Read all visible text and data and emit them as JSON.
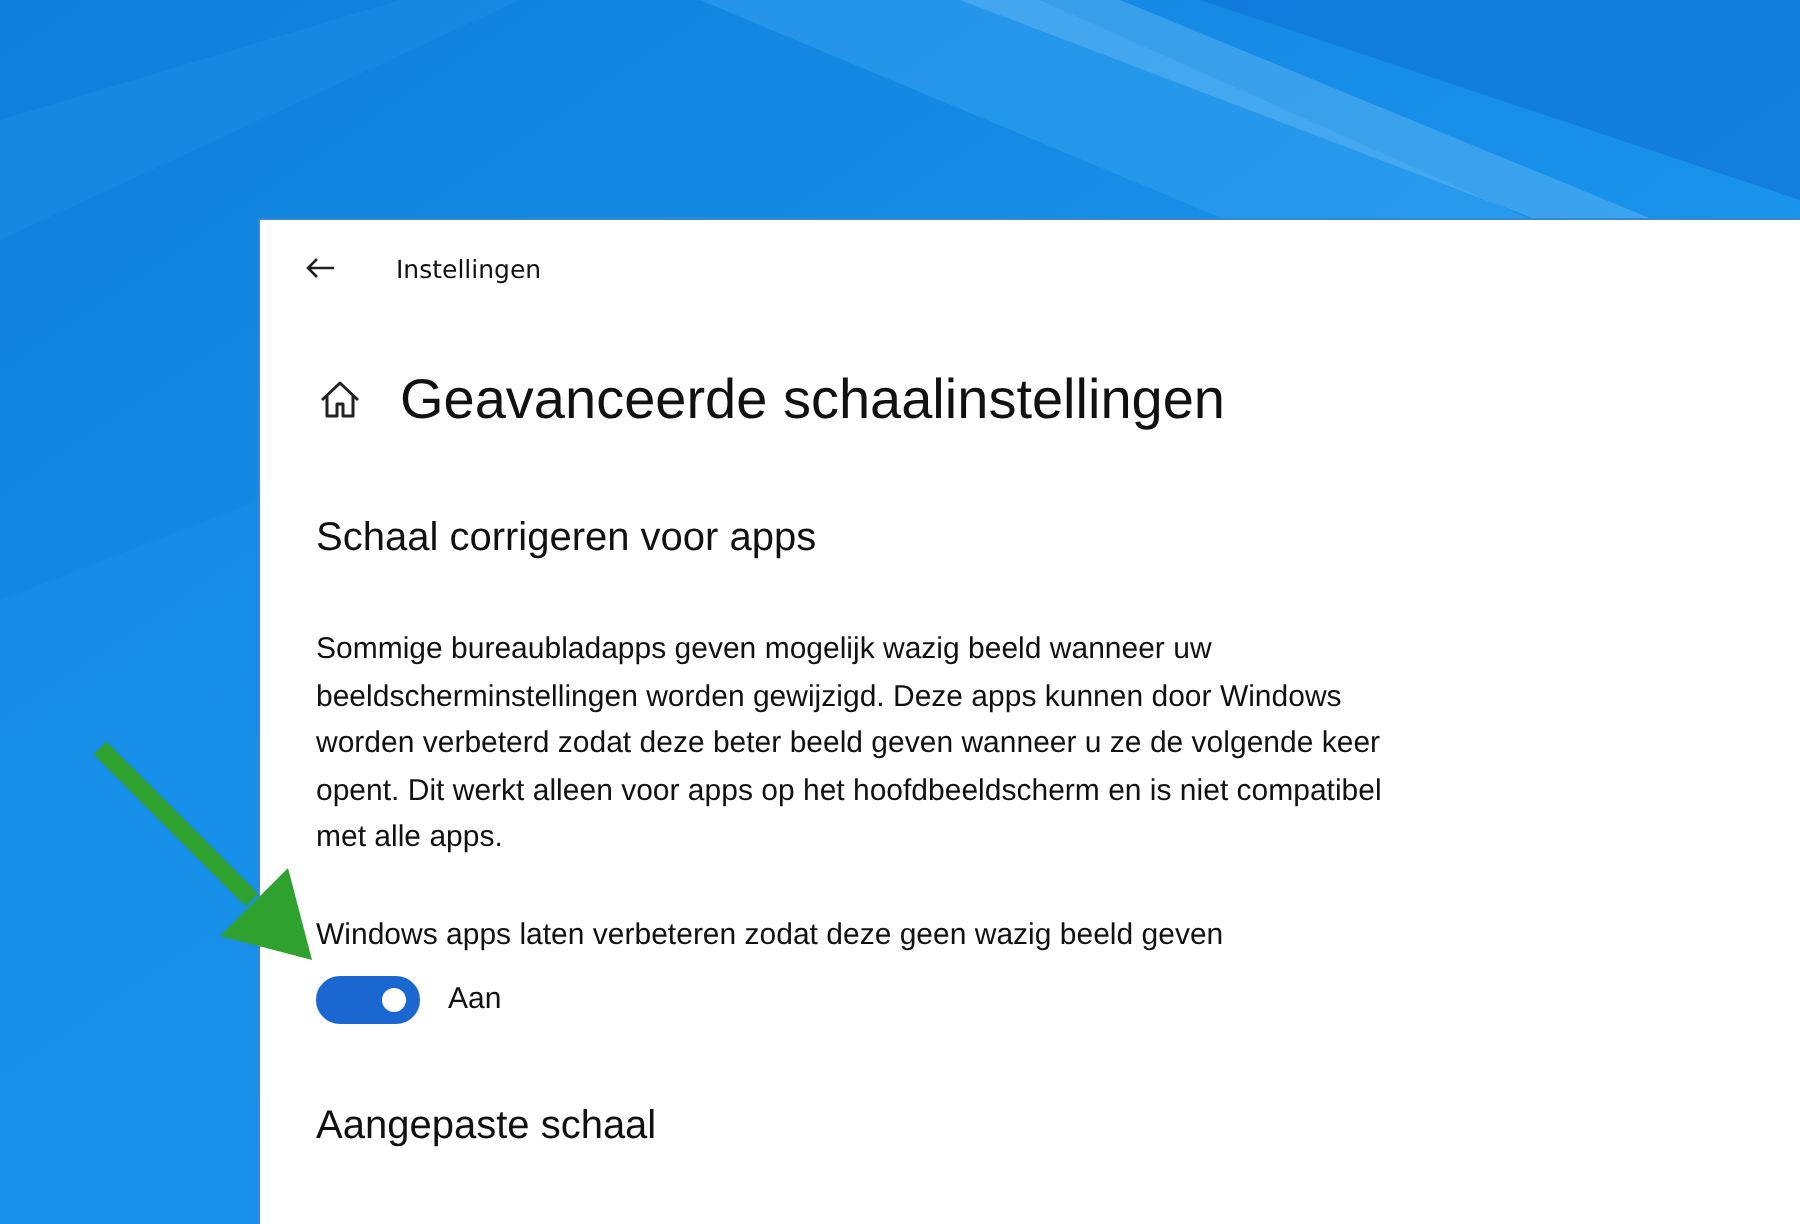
{
  "window": {
    "title": "Instellingen"
  },
  "page": {
    "title": "Geavanceerde schaalinstellingen"
  },
  "sections": [
    {
      "heading": "Schaal corrigeren voor apps",
      "description": "Sommige bureaubladapps geven mogelijk wazig beeld wanneer uw beeldscherminstellingen worden gewijzigd. Deze apps kunnen door Windows worden verbeterd zodat deze beter beeld geven wanneer u ze de volgende keer opent. Dit werkt alleen voor apps op het hoofdbeeldscherm en is niet compatibel met alle apps.",
      "toggle": {
        "label": "Windows apps laten verbeteren zodat deze geen wazig beeld geven",
        "on": true,
        "state_text": "Aan"
      }
    },
    {
      "heading": "Aangepaste schaal"
    }
  ]
}
